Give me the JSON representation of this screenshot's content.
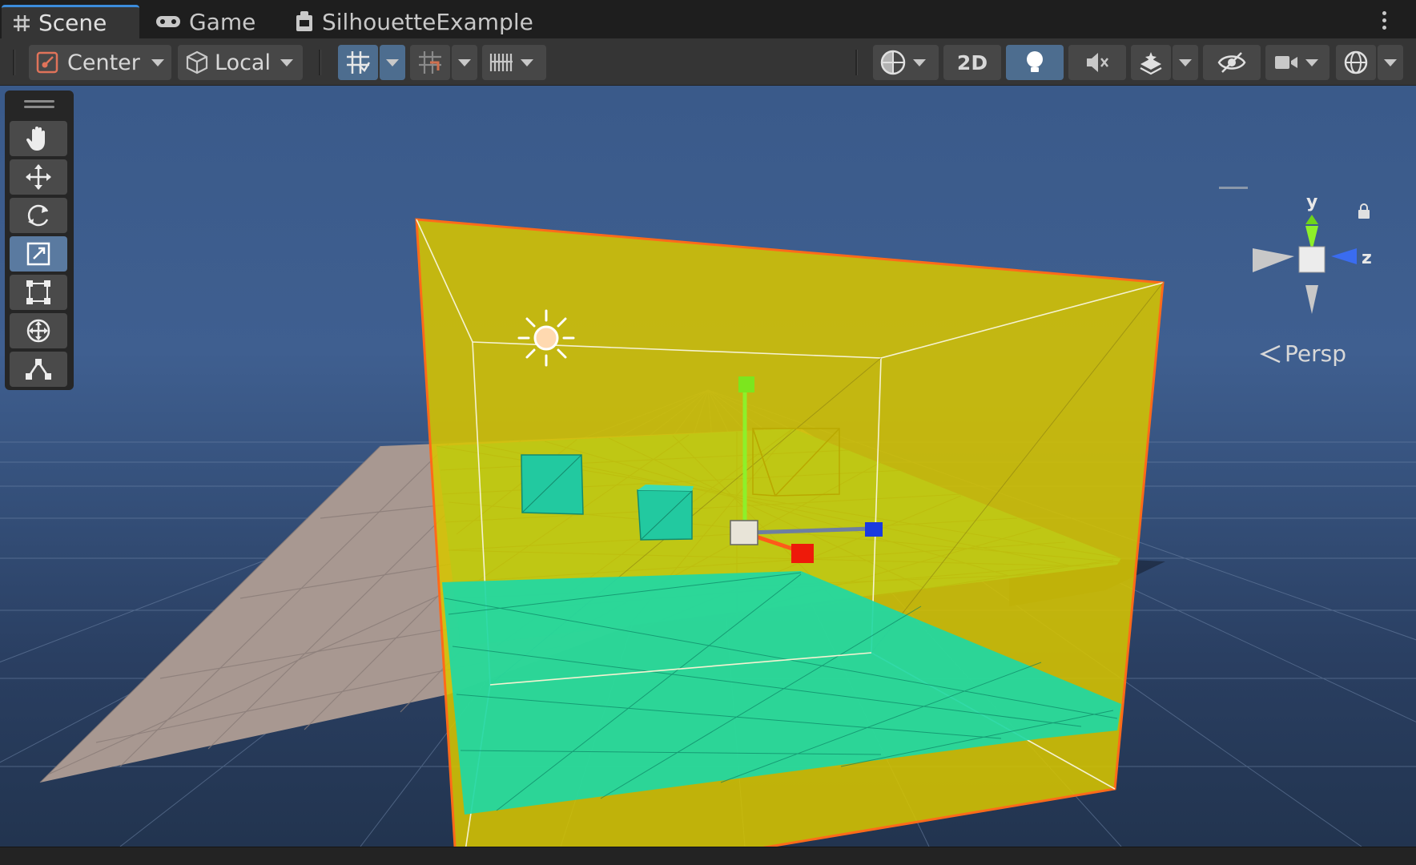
{
  "tabs": [
    {
      "label": "Scene",
      "icon": "grid-hash-icon",
      "active": true
    },
    {
      "label": "Game",
      "icon": "gamepad-icon",
      "active": false
    },
    {
      "label": "SilhouetteExample",
      "icon": "scene-asset-icon",
      "active": false
    }
  ],
  "toolbar": {
    "pivot_mode": "Center",
    "pivot_rotation": "Local",
    "view_2d": "2D"
  },
  "gizmo": {
    "axis_y": "y",
    "axis_z": "z",
    "projection": "Persp"
  },
  "colors": {
    "selection_box": "#d6c400",
    "floor": "#1fd8a4",
    "ground_plane": "#a89891",
    "selection_outline": "#ff6a1a",
    "accent": "#3c8cdb"
  }
}
